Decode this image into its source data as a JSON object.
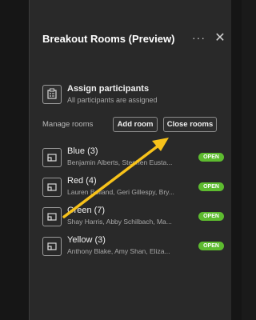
{
  "panel": {
    "title": "Breakout Rooms (Preview)",
    "more_label": "···",
    "close_label": "✕"
  },
  "assign": {
    "title": "Assign participants",
    "subtitle": "All participants are assigned"
  },
  "manage": {
    "label": "Manage rooms",
    "add_room": "Add room",
    "close_rooms": "Close rooms"
  },
  "rooms": [
    {
      "name": "Blue (3)",
      "members": "Benjamin Alberts, Stephen Eusta...",
      "status": "OPEN"
    },
    {
      "name": "Red (4)",
      "members": "Lauren Bolland, Geri Gillespy, Bry...",
      "status": "OPEN"
    },
    {
      "name": "Green (7)",
      "members": "Shay Harris, Abby Schilbach, Ma...",
      "status": "OPEN"
    },
    {
      "name": "Yellow (3)",
      "members": "Anthony Blake, Amy Shan, Eliza...",
      "status": "OPEN"
    }
  ],
  "colors": {
    "accent_open": "#5dbb2f",
    "annotation_arrow": "#f7c21a",
    "panel_bg": "#292929"
  }
}
